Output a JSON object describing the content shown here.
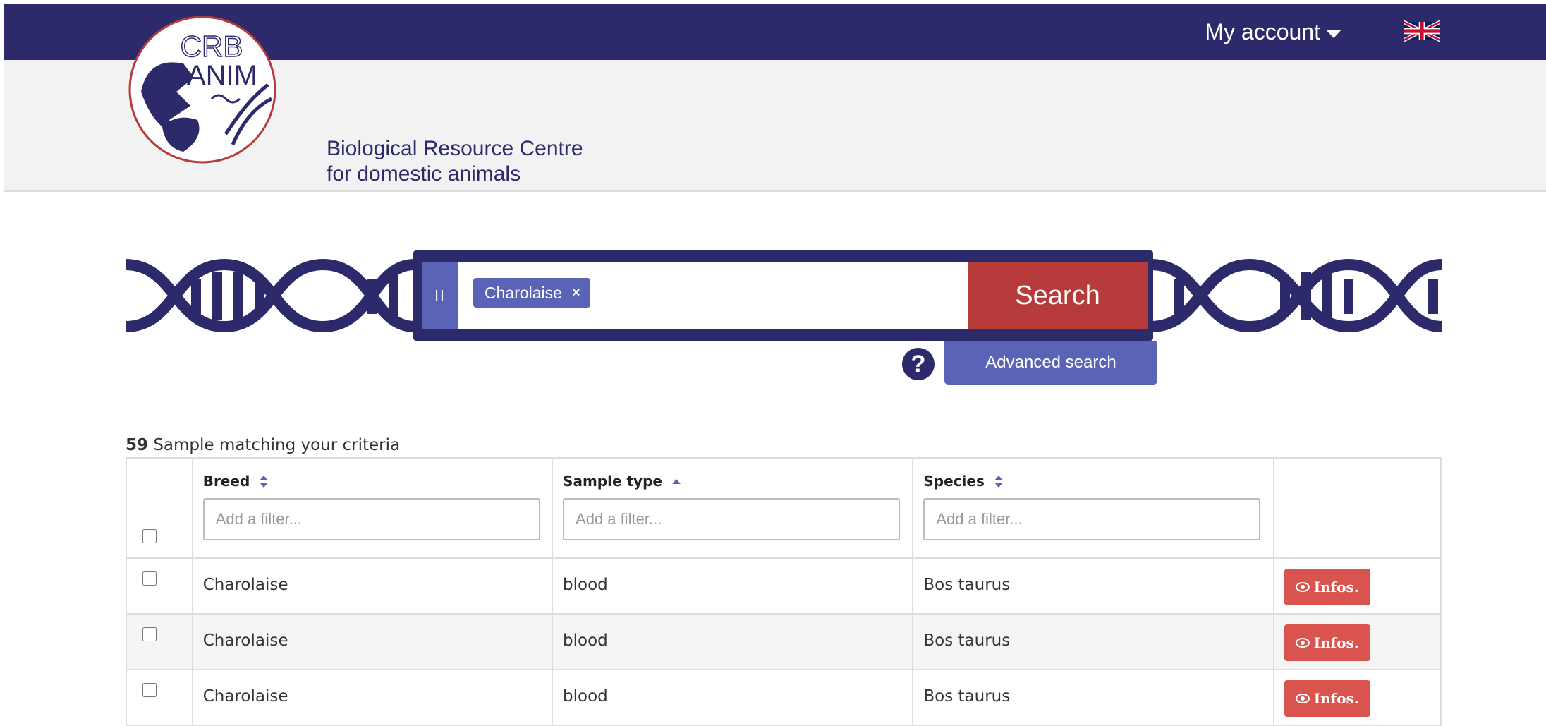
{
  "header": {
    "account_label": "My account",
    "tagline_line1": "Biological Resource Centre",
    "tagline_line2": "for domestic animals",
    "logo_text_top": "CRB",
    "logo_text_bottom": "ANIM",
    "brand_color": "#2d2a6b"
  },
  "search": {
    "handle_label": "II",
    "tag_label": "Charolaise",
    "tag_remove": "×",
    "button_label": "Search",
    "help_label": "?",
    "advanced_label": "Advanced search"
  },
  "results": {
    "count": "59",
    "count_text": "Sample matching your criteria",
    "columns": [
      {
        "label": "Breed",
        "placeholder": "Add a filter..."
      },
      {
        "label": "Sample type",
        "placeholder": "Add a filter..."
      },
      {
        "label": "Species",
        "placeholder": "Add a filter..."
      }
    ],
    "rows": [
      {
        "breed": "Charolaise",
        "sample_type": "blood",
        "species": "Bos taurus",
        "action": "Infos."
      },
      {
        "breed": "Charolaise",
        "sample_type": "blood",
        "species": "Bos taurus",
        "action": "Infos."
      },
      {
        "breed": "Charolaise",
        "sample_type": "blood",
        "species": "Bos taurus",
        "action": "Infos."
      }
    ]
  }
}
